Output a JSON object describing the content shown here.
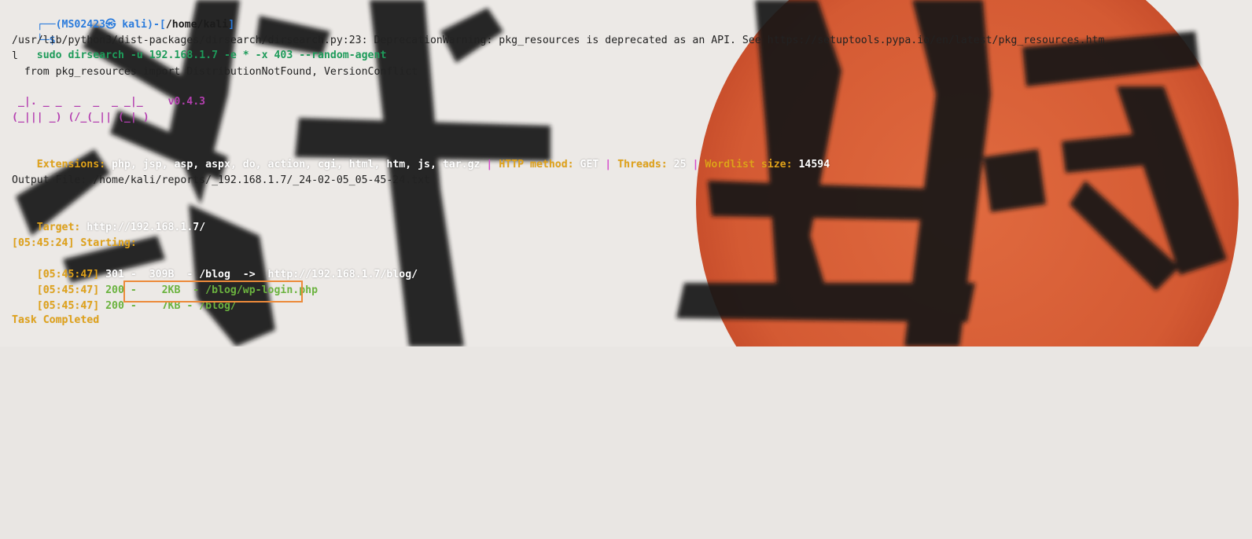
{
  "prompt": {
    "frame_prefix": "┌──(",
    "user_host": "MS02423㉿ kali",
    "frame_mid": ")-[",
    "cwd": "/home/kali",
    "frame_suffix": "]",
    "arrow": "└─$",
    "command": "sudo dirsearch -u 192.168.1.7 -e * -x 403 --random-agent"
  },
  "warning": {
    "line1": "/usr/lib/python3/dist-packages/dirsearch/dirsearch.py:23: DeprecationWarning: pkg_resources is deprecated as an API. See https://setuptools.pypa.io/en/latest/pkg_resources.htm",
    "line2": "l",
    "line3": "  from pkg_resources import DistributionNotFound, VersionConflict"
  },
  "banner": {
    "line1": " _|. _ _  _  _  _ _|_    v0.4.3",
    "line2": "(_||| _) (/_(_|| (_| )"
  },
  "config": {
    "extensions_label": "Extensions:",
    "extensions_value": " php, jsp, asp, aspx, do, action, cgi, html, htm, js, tar.gz ",
    "sep1": "|",
    "method_label": " HTTP method:",
    "method_value": " GET ",
    "sep2": "|",
    "threads_label": " Threads:",
    "threads_value": " 25 ",
    "sep3": "|",
    "wordlist_label": " Wordlist size:",
    "wordlist_value": " 14594"
  },
  "output_file": "Output File: /home/kali/reports/_192.168.1.7/_24-02-05_05-45-24.txt",
  "target": {
    "label": "Target:",
    "value": " http://192.168.1.7/"
  },
  "results": {
    "starting": "[05:45:24] Starting:",
    "rows": [
      {
        "time": "[05:45:47]",
        "status": " 301 -",
        "size": "  309B",
        "path": "  - /blog  ->  http://192.168.1.7/blog/"
      },
      {
        "time": "[05:45:47]",
        "status": " 200 -",
        "size": "    2KB",
        "path": "  - /blog/wp-login.php"
      },
      {
        "time": "[05:45:47]",
        "status": " 200 -",
        "size": "    7KB",
        "path": " - /blog/"
      }
    ]
  },
  "task_completed": "Task Completed",
  "colors": {
    "highlight_box": "#ec8a3a",
    "wallpaper_sun": "#d9613a",
    "ink": "#111111"
  }
}
